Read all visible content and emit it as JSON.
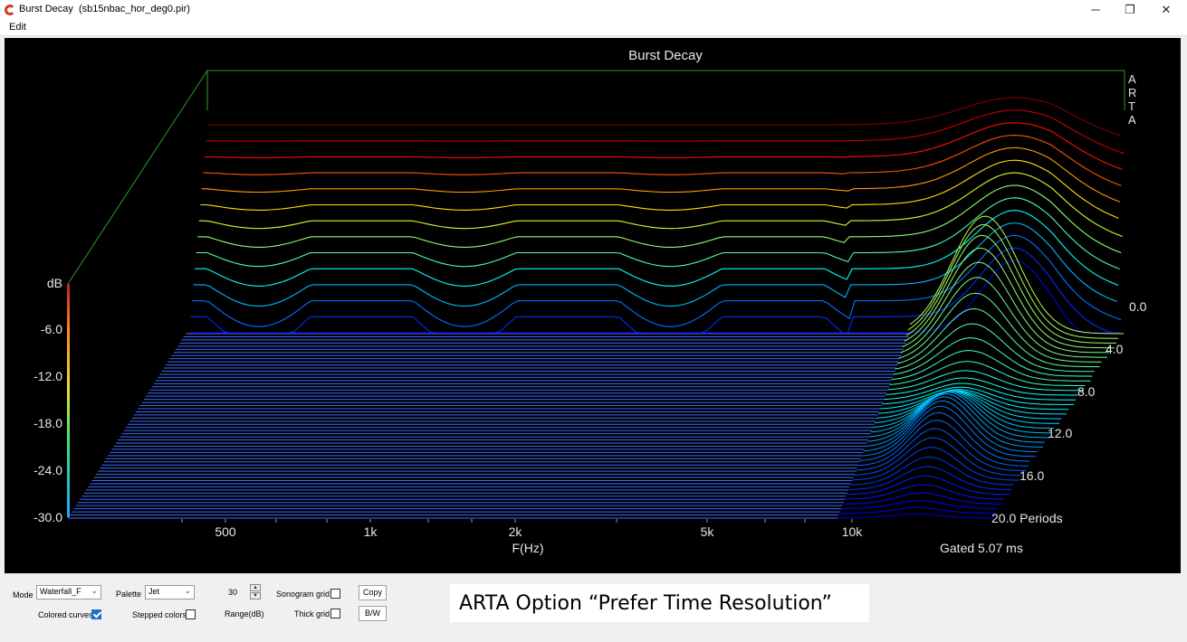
{
  "window": {
    "title": "Burst Decay  (sb15nbac_hor_deg0.pir)",
    "minimize_glyph": "─",
    "restore_glyph": "❐",
    "close_glyph": "✕"
  },
  "menu": {
    "edit": "Edit"
  },
  "plot": {
    "title": "Burst Decay",
    "watermark": "ARTA",
    "db_label": "dB",
    "db_ticks": [
      "-6.0",
      "-12.0",
      "-18.0",
      "-24.0",
      "-30.0"
    ],
    "freq_ticks": [
      "500",
      "1k",
      "2k",
      "5k",
      "10k"
    ],
    "freq_label": "F(Hz)",
    "period_ticks": [
      "0.0",
      "4.0",
      "8.0",
      "12.0",
      "16.0",
      "20.0 Periods"
    ],
    "gated_label": "Gated 5.07 ms",
    "colors": {
      "background": "#000000",
      "frame": "#2e9a2e",
      "text": "#e6e6e6"
    }
  },
  "controls": {
    "mode_label": "Mode",
    "mode_value": "Waterfall_F",
    "palette_label": "Palette",
    "palette_value": "Jet",
    "range_value": "30",
    "range_label": "Range(dB)",
    "sonogram_grid_label": "Sonogram grid",
    "thick_grid_label": "Thick grid",
    "colored_curves_label": "Colored curves",
    "stepped_colors_label": "Stepped colors",
    "copy_label": "Copy",
    "bw_label": "B/W",
    "colored_curves_checked": true,
    "stepped_colors_checked": false,
    "sonogram_grid_checked": false,
    "thick_grid_checked": false
  },
  "caption": "ARTA Option “Prefer Time Resolution”"
}
